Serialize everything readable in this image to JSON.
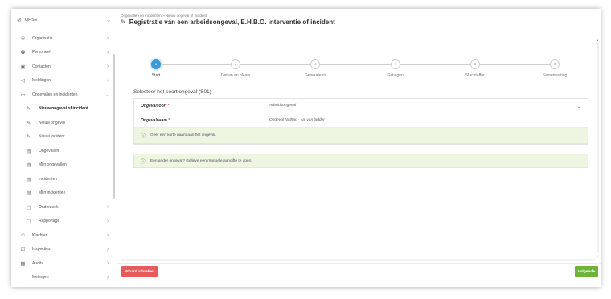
{
  "app": {
    "brand": "QHSE"
  },
  "sidebar": {
    "items": [
      {
        "label": "Organisatie",
        "icon": "org-chart-icon",
        "has_children": true
      },
      {
        "label": "Personeel",
        "icon": "people-icon",
        "has_children": true
      },
      {
        "label": "Contacten",
        "icon": "contacts-icon",
        "has_children": true
      },
      {
        "label": "Meldingen",
        "icon": "megaphone-icon",
        "has_children": true
      },
      {
        "label": "Ongevallen en incidenten",
        "icon": "ambulance-icon",
        "has_children": true,
        "expanded": true
      },
      {
        "label": "Nieuw ongeval of incident",
        "icon": "pencil-icon",
        "sub": true,
        "active": true
      },
      {
        "label": "Nieuw ongeval",
        "icon": "pencil-icon",
        "sub": true
      },
      {
        "label": "Nieuw incident",
        "icon": "pencil-icon",
        "sub": true
      },
      {
        "label": "Ongevallen",
        "icon": "document-icon",
        "sub": true
      },
      {
        "label": "Mijn ongevallen",
        "icon": "document-icon",
        "sub": true
      },
      {
        "label": "Incidenten",
        "icon": "document-icon",
        "sub": true
      },
      {
        "label": "Mijn incidenten",
        "icon": "document-icon",
        "sub": true
      },
      {
        "label": "Onderzoek",
        "icon": "folder-icon",
        "sub": true,
        "has_children": true
      },
      {
        "label": "Rapportage",
        "icon": "folder-icon",
        "sub": true,
        "has_children": true
      },
      {
        "label": "Klachten",
        "icon": "smiley-icon",
        "has_children": true
      },
      {
        "label": "Inspecties",
        "icon": "checkbox-icon",
        "has_children": true
      },
      {
        "label": "Audits",
        "icon": "calendar-icon",
        "has_children": true
      },
      {
        "label": "Metingen",
        "icon": "chart-icon",
        "has_children": true
      }
    ]
  },
  "header": {
    "breadcrumb": "Ongevallen en incidenten > Nieuw ongeval of incident",
    "title": "Registratie van een arbeidsongeval, E.H.B.O. interventie of incident"
  },
  "stepper": {
    "steps": [
      {
        "num": "1",
        "label": "Start",
        "active": true
      },
      {
        "num": "2",
        "label": "Datum en plaats"
      },
      {
        "num": "3",
        "label": "Gebeurtenis"
      },
      {
        "num": "4",
        "label": "Getuigen"
      },
      {
        "num": "5",
        "label": "Slachtoffer"
      },
      {
        "num": "6",
        "label": "Samenvatting"
      }
    ]
  },
  "form": {
    "section_title": "Selecteer het soort ongeval (S01)",
    "ongevalsoort_label": "Ongevalsoort",
    "ongevalsoort_value": "Arbeidsongeval",
    "ongevalnaam_label": "Ongevalnaam",
    "ongevalnaam_value": "Ongeval Nathan - val van ladder",
    "required_marker": "*",
    "hint": "Geef een korte naam aan het ongeval.",
    "notice": "Een ander ongeval? Gelieve een manuele aangifte te doen."
  },
  "footer": {
    "cancel_label": "Wizard afbreken",
    "next_label": "Volgende"
  },
  "colors": {
    "accent": "#3a9ad9",
    "danger": "#e85b5b",
    "success": "#6fb33a",
    "hint_bg": "#eef5e1"
  }
}
